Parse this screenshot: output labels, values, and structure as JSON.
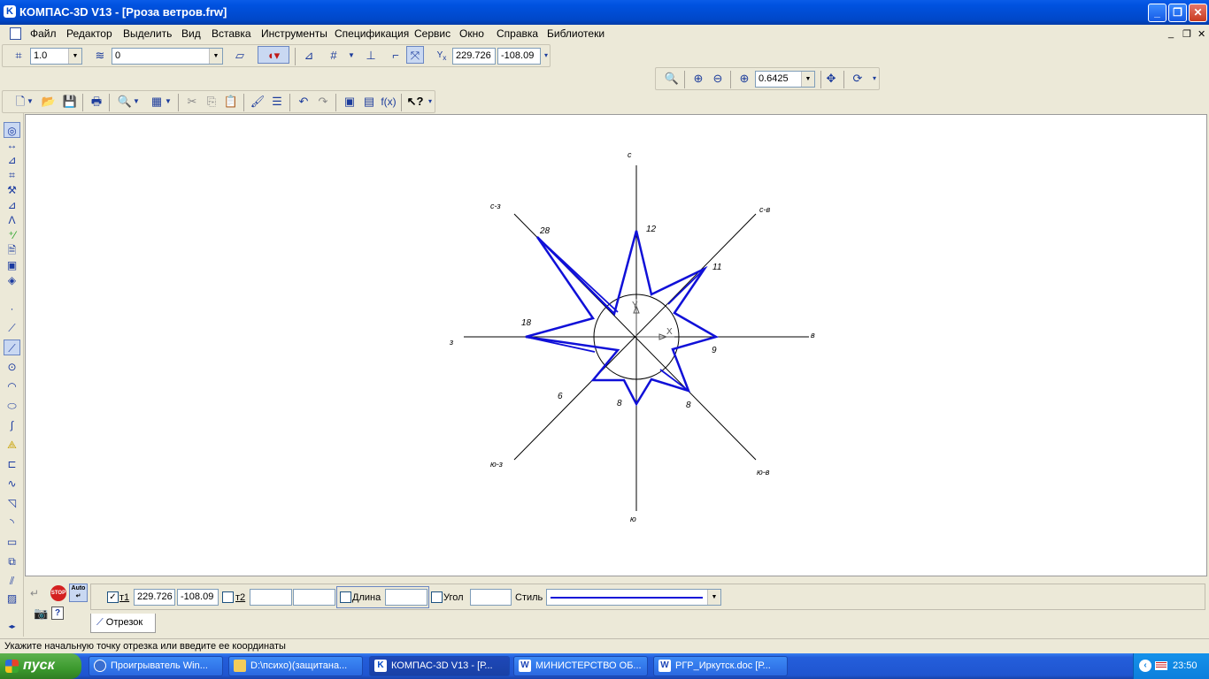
{
  "window": {
    "title": "КОМПАС-3D V13 - [Рроза ветров.frw]"
  },
  "menu": [
    "Файл",
    "Редактор",
    "Выделить",
    "Вид",
    "Вставка",
    "Инструменты",
    "Спецификация",
    "Сервис",
    "Окно",
    "Справка",
    "Библиотеки"
  ],
  "toolbar_current": {
    "step_value": "1.0",
    "layer_value": "0",
    "coord_x": "229.726",
    "coord_y": "-108.09"
  },
  "view_toolbar": {
    "zoom_value": "0.6425"
  },
  "drawing": {
    "directions": {
      "n": "с",
      "ne": "с-в",
      "e": "в",
      "se": "ю-в",
      "s": "ю",
      "sw": "ю-з",
      "w": "з",
      "nw": "с-з"
    },
    "values": {
      "n": "12",
      "ne": "11",
      "e": "9",
      "se": "8",
      "s": "8",
      "sw": "6",
      "w": "18",
      "nw": "28"
    },
    "origin_y_label": "Y",
    "origin_x_label": "X"
  },
  "property_panel": {
    "t1_label": "т1",
    "t1_x": "229.726",
    "t1_y": "-108.09",
    "t2_label": "т2",
    "t2_x": "",
    "t2_y": "",
    "length_label": "Длина",
    "length_value": "",
    "angle_label": "Угол",
    "angle_value": "",
    "style_label": "Стиль",
    "tab_label": "Отрезок",
    "stop_label": "STOP",
    "auto_label": "Auto"
  },
  "statusbar": {
    "text": "Укажите начальную точку отрезка или введите ее координаты"
  },
  "taskbar": {
    "start_label": "пуск",
    "tasks": [
      "Проигрыватель Win...",
      "D:\\психо)(защитана...",
      "КОМПАС-3D V13 - [Р...",
      "МИНИСТЕРСТВО  ОБ...",
      "РГР_Иркутск.doc [Р..."
    ],
    "clock": "23:50"
  },
  "colors": {
    "titlebar": "#0052e0",
    "rose_line": "#1010d8",
    "taskbar": "#245edb",
    "start": "#3c9a2e"
  }
}
